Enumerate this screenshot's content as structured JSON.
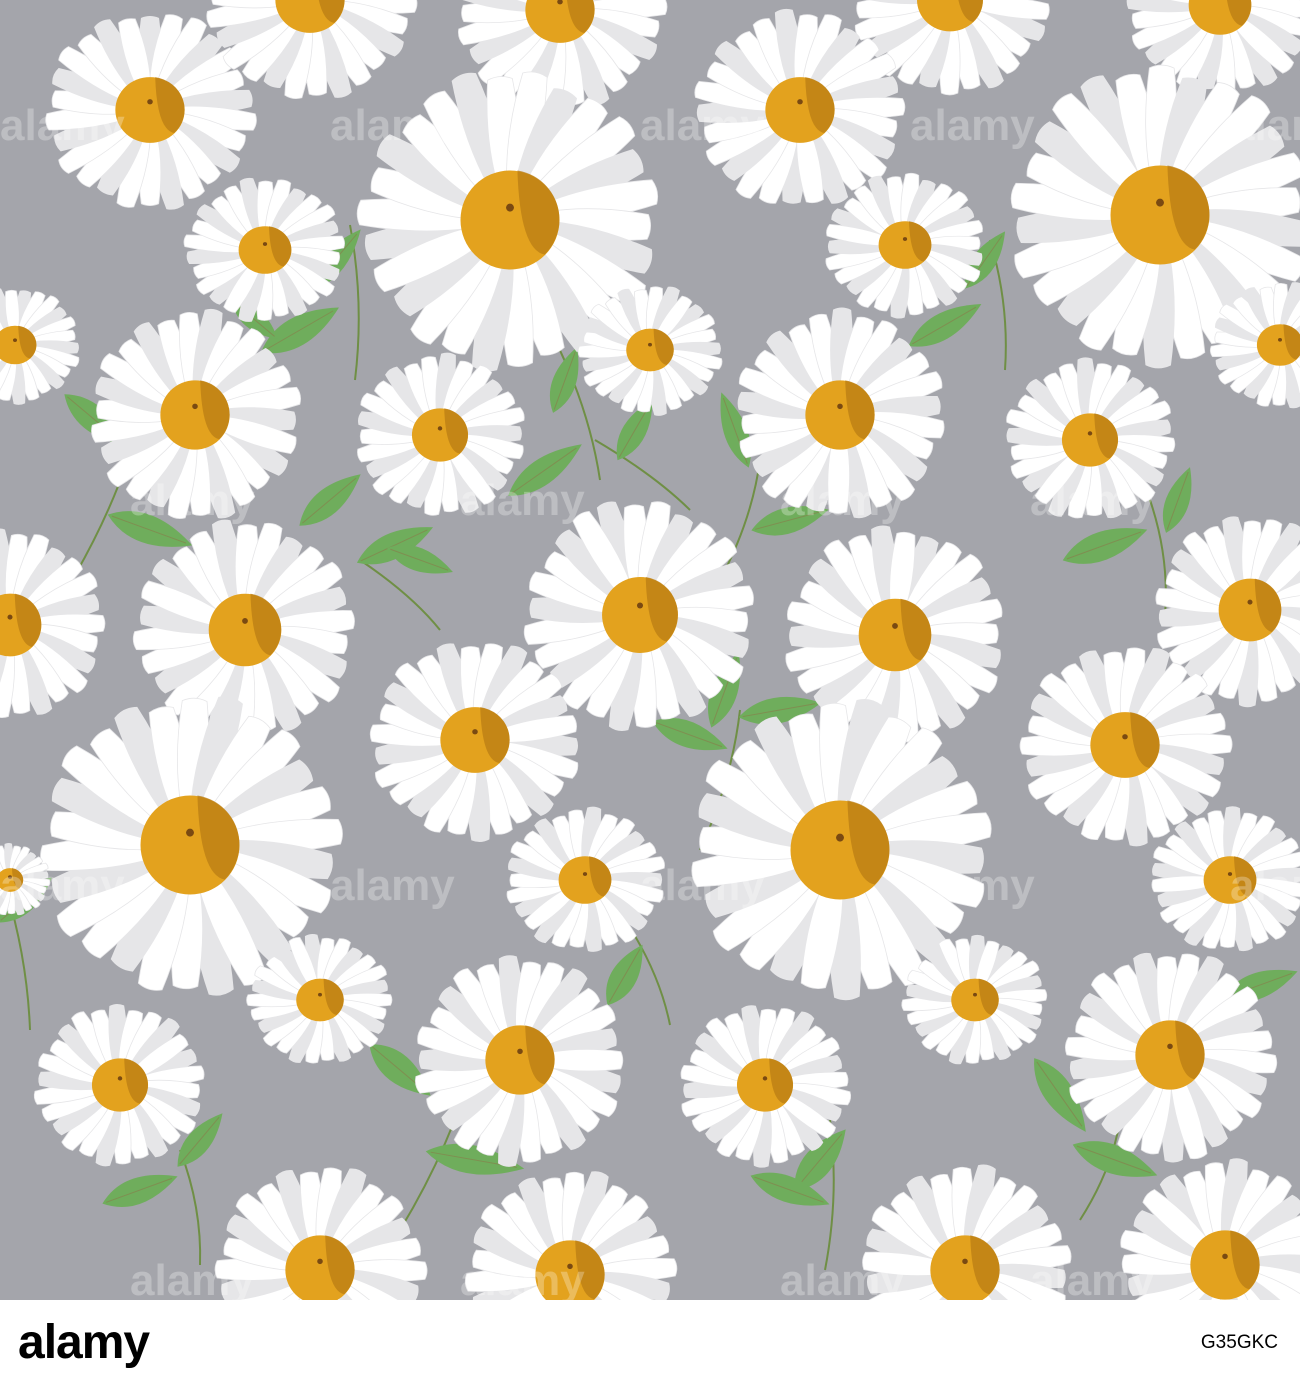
{
  "image": {
    "subject": "seamless pattern of white daisies with green leaves",
    "background_color": "#a4a5ab",
    "petal_color": "#ffffff",
    "petal_shadow_color": "#e6e6e8",
    "center_color": "#e3a21e",
    "center_shadow_color": "#b77a12",
    "center_dark_color": "#7a4a12",
    "leaf_color": "#6fad5c",
    "leaf_vein_color": "#8a7a4a",
    "stem_color": "#6f8f45"
  },
  "watermark": {
    "text": "alamy"
  },
  "footer": {
    "logo_text": "alamy",
    "image_id": "G35GKC",
    "small_credit": ""
  }
}
